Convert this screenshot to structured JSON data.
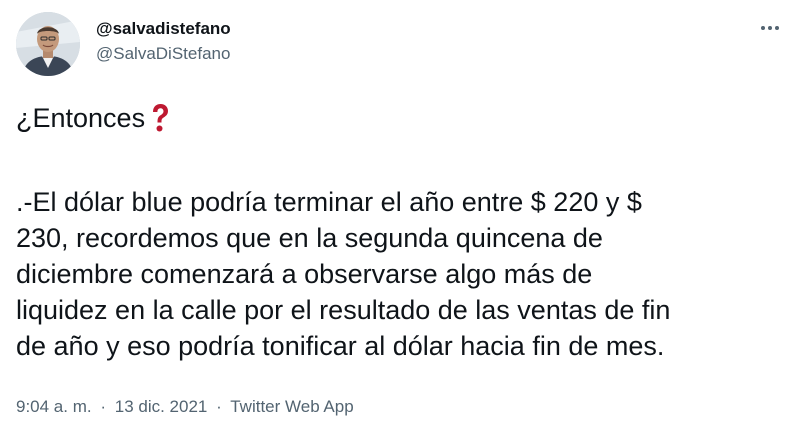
{
  "tweet": {
    "author": {
      "display_name": "@salvadistefano",
      "handle": "@SalvaDiStefano",
      "avatar": "person-avatar"
    },
    "more_icon": "more-dots-icon",
    "intro_text": "¿Entonces",
    "intro_emoji": "red-question-mark-icon",
    "body": ".-El dólar blue podría terminar el año entre $ 220 y $\n230, recordemos que en la segunda quincena de\ndiciembre comenzará a observarse algo más de\nliquidez en la calle por el resultado de las ventas de fin\nde año y eso podría tonificar al dólar hacia fin de mes.",
    "time": "9:04 a. m.",
    "separator": "·",
    "date": "13 dic. 2021",
    "source": "Twitter Web App"
  },
  "colors": {
    "text": "#0f1419",
    "secondary": "#536471",
    "emoji_red": "#be1931",
    "background": "#ffffff"
  }
}
